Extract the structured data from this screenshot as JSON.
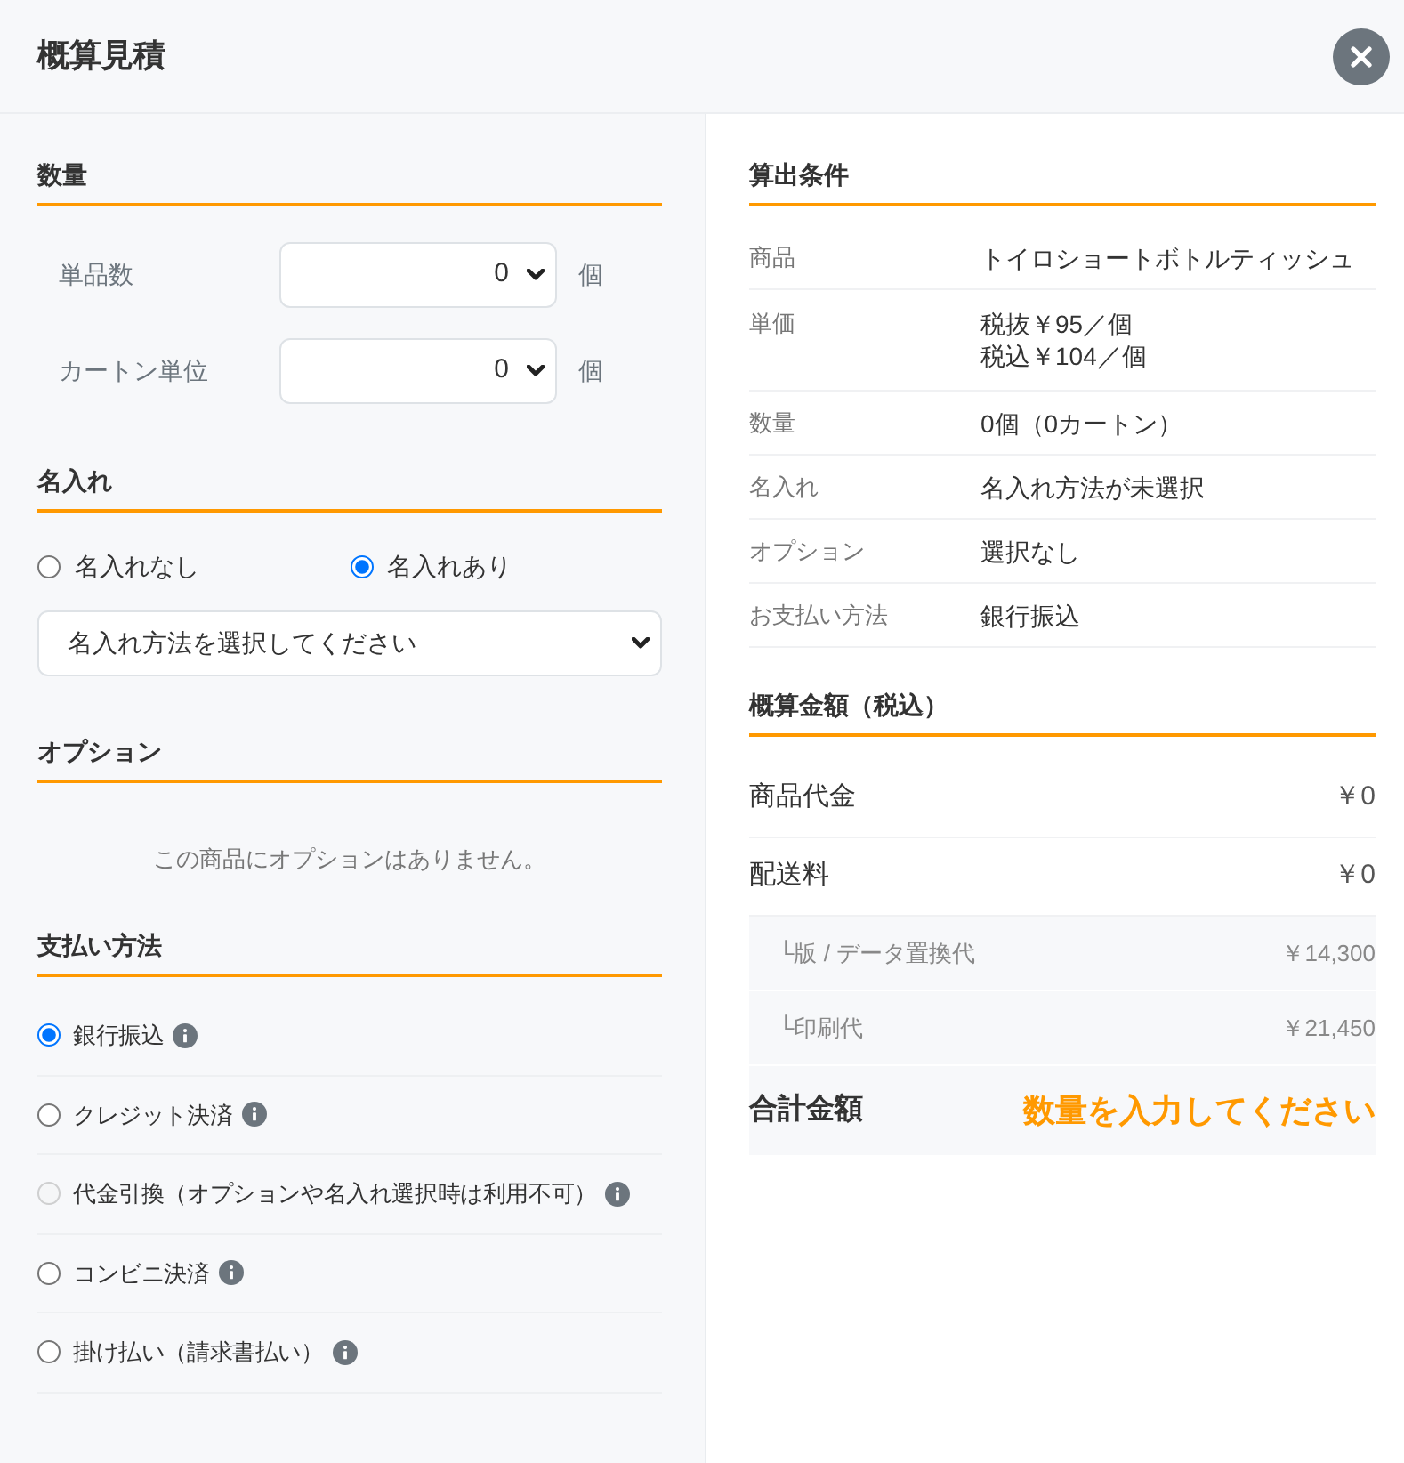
{
  "window": {
    "title": "概算見積"
  },
  "quantity": {
    "heading": "数量",
    "rows": [
      {
        "label": "単品数",
        "value": "0",
        "unit": "個"
      },
      {
        "label": "カートン単位",
        "value": "0",
        "unit": "個"
      }
    ]
  },
  "name_imprint": {
    "heading": "名入れ",
    "options": [
      {
        "label": "名入れなし",
        "selected": false
      },
      {
        "label": "名入れあり",
        "selected": true
      }
    ],
    "method_select": {
      "value": "名入れ方法を選択してください"
    }
  },
  "options": {
    "heading": "オプション",
    "message": "この商品にオプションはありません。"
  },
  "payment": {
    "heading": "支払い方法",
    "methods": [
      {
        "label": "銀行振込",
        "selected": true,
        "disabled": false
      },
      {
        "label": "クレジット決済",
        "selected": false,
        "disabled": false
      },
      {
        "label": "代金引換（オプションや名入れ選択時は利用不可）",
        "selected": false,
        "disabled": true
      },
      {
        "label": "コンビニ決済",
        "selected": false,
        "disabled": false
      },
      {
        "label": "掛け払い（請求書払い）",
        "selected": false,
        "disabled": false
      }
    ]
  },
  "conditions": {
    "heading": "算出条件",
    "rows": [
      {
        "label": "商品",
        "lines": [
          "トイロショートボトルティッシュ"
        ]
      },
      {
        "label": "単価",
        "lines": [
          "税抜￥95／個",
          "税込￥104／個"
        ]
      },
      {
        "label": "数量",
        "lines": [
          "0個（0カートン）"
        ]
      },
      {
        "label": "名入れ",
        "lines": [
          "名入れ方法が未選択"
        ]
      },
      {
        "label": "オプション",
        "lines": [
          "選択なし"
        ]
      },
      {
        "label": "お支払い方法",
        "lines": [
          "銀行振込"
        ]
      }
    ]
  },
  "estimate": {
    "heading": "概算金額（税込）",
    "rows": [
      {
        "kind": "main",
        "label": "商品代金",
        "value": "￥0"
      },
      {
        "kind": "main",
        "label": "配送料",
        "value": "￥0"
      },
      {
        "kind": "sub",
        "label": "└版 / データ置換代",
        "value": "￥14,300"
      },
      {
        "kind": "sub",
        "label": "└印刷代",
        "value": "￥21,450"
      }
    ],
    "total": {
      "label": "合計金額",
      "value": "数量を入力してください"
    }
  }
}
